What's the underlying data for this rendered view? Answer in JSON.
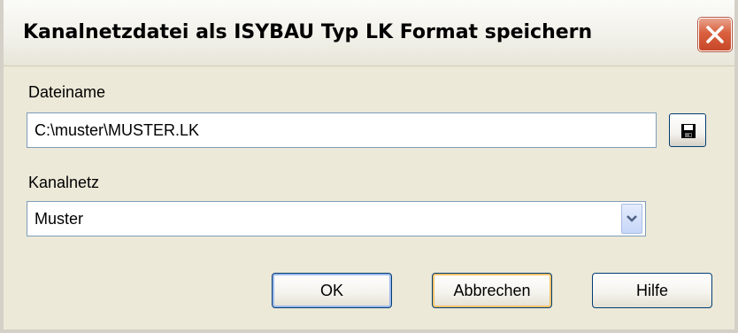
{
  "window": {
    "title": "Kanalnetzdatei als ISYBAU Typ LK Format speichern"
  },
  "filename": {
    "label": "Dateiname",
    "value": "C:\\muster\\MUSTER.LK"
  },
  "network": {
    "label": "Kanalnetz",
    "selected": "Muster"
  },
  "buttons": {
    "ok": "OK",
    "cancel": "Abbrechen",
    "help": "Hilfe"
  },
  "icons": {
    "close": "close-icon",
    "save": "floppy-disk-icon",
    "dropdown": "chevron-down-icon"
  },
  "colors": {
    "dialog_bg": "#ECE9D8",
    "close_red": "#D9603E",
    "button_border": "#003C74",
    "focus_orange": "#F5C26A"
  }
}
